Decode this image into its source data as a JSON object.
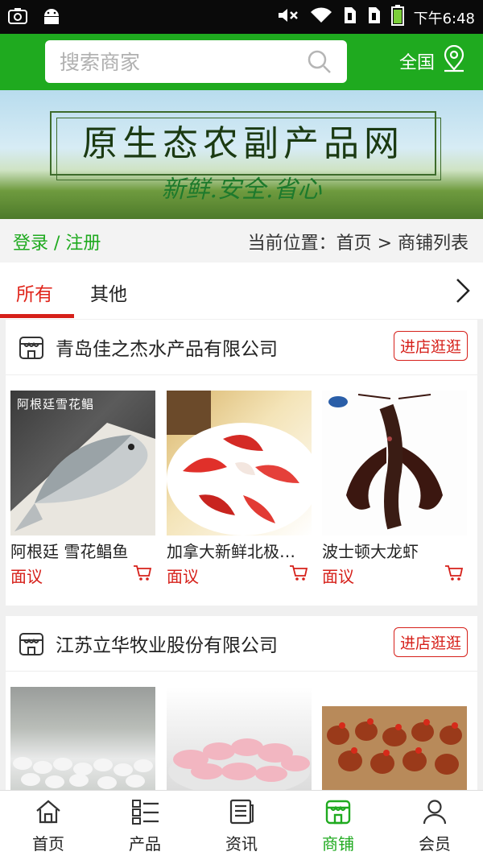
{
  "status_bar": {
    "time": "下午6:48"
  },
  "header": {
    "search_placeholder": "搜索商家",
    "region_label": "全国"
  },
  "banner": {
    "title": "原生态农副产品网",
    "slogan": "新鲜.安全.省心"
  },
  "location_bar": {
    "login_label": "登录 / 注册",
    "breadcrumb": "当前位置：首页 > 商铺列表"
  },
  "tabs": [
    {
      "label": "所有",
      "active": true
    },
    {
      "label": "其他",
      "active": false
    }
  ],
  "shops": [
    {
      "name": "青岛佳之杰水产品有限公司",
      "visit_label": "进店逛逛",
      "products": [
        {
          "name": "阿根廷 雪花鲳鱼",
          "price": "面议",
          "image_text": "阿根廷雪花鲳"
        },
        {
          "name": "加拿大新鲜北极…",
          "price": "面议"
        },
        {
          "name": "波士顿大龙虾",
          "price": "面议"
        }
      ]
    },
    {
      "name": "江苏立华牧业股份有限公司",
      "visit_label": "进店逛逛",
      "products": [
        {
          "name": ""
        },
        {
          "name": ""
        },
        {
          "name": ""
        }
      ]
    }
  ],
  "bottom_nav": [
    {
      "label": "首页",
      "icon": "home-icon"
    },
    {
      "label": "产品",
      "icon": "list-icon"
    },
    {
      "label": "资讯",
      "icon": "news-icon"
    },
    {
      "label": "商铺",
      "icon": "store-icon",
      "active": true
    },
    {
      "label": "会员",
      "icon": "user-icon"
    }
  ],
  "colors": {
    "brand_green": "#1faa1f",
    "accent_red": "#d6201a"
  }
}
